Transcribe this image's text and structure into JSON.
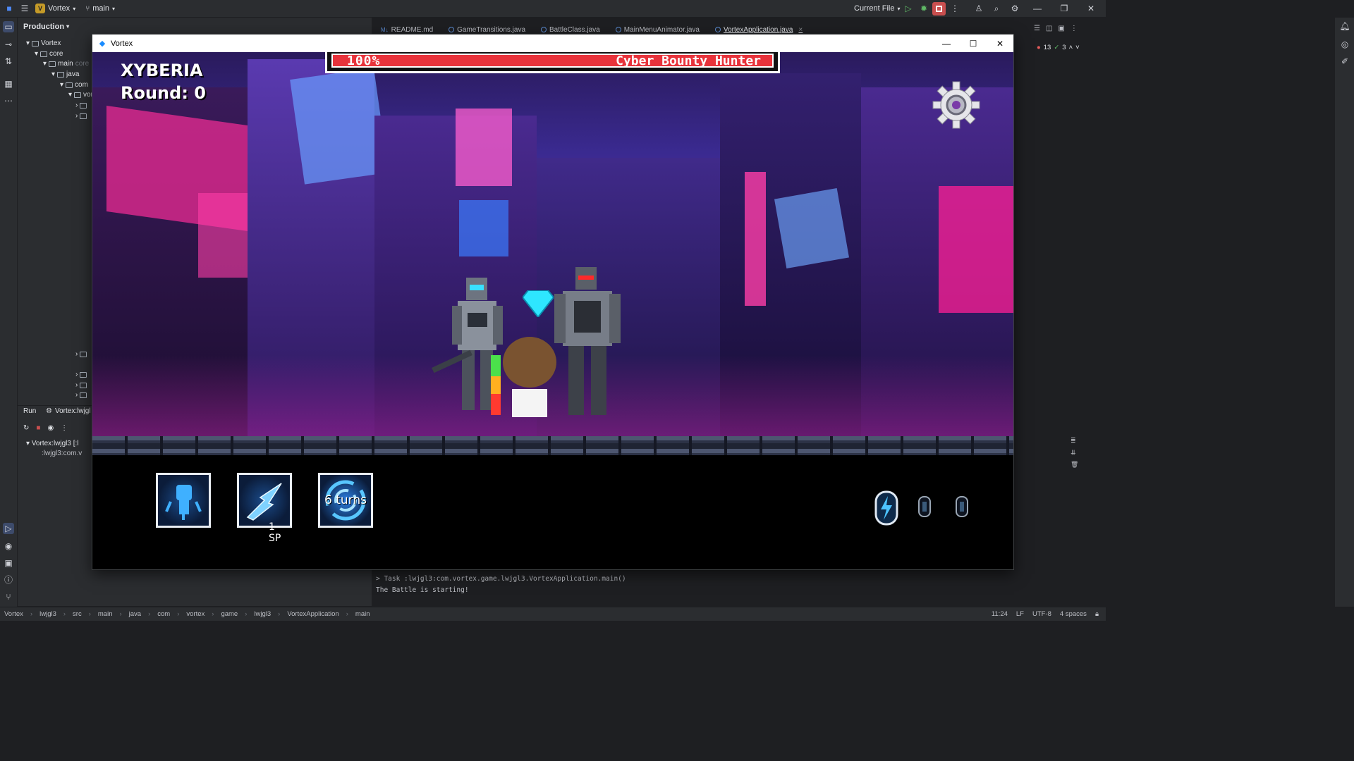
{
  "ide": {
    "project_name": "Vortex",
    "project_badge": "V",
    "branch": "main",
    "run_config": "Current File",
    "project_pane_title": "Production",
    "tree": [
      {
        "label": "Vortex",
        "depth": 0
      },
      {
        "label": "core",
        "depth": 1
      },
      {
        "label": "main",
        "depth": 2,
        "suffix": "core"
      },
      {
        "label": "java",
        "depth": 3
      },
      {
        "label": "com",
        "depth": 4
      },
      {
        "label": "vor",
        "depth": 5
      }
    ],
    "tabs": [
      {
        "label": "README.md",
        "active": false
      },
      {
        "label": "GameTransitions.java",
        "active": false
      },
      {
        "label": "BattleClass.java",
        "active": false
      },
      {
        "label": "MainMenuAnimator.java",
        "active": false
      },
      {
        "label": "VortexApplication.java",
        "active": true
      }
    ],
    "problems": {
      "errors": "13",
      "warnings": "3"
    },
    "run_tab": "Run",
    "run_config_tab": "Vortex:lwjgl",
    "run_tree": [
      "Vortex:lwjgl3 [:l",
      ":lwjgl3:com.v"
    ],
    "console_lines": [
      "> Task :lwjgl3:com.vortex.game.lwjgl3.VortexApplication.main()",
      "The Battle is starting!"
    ],
    "breadcrumb": [
      "Vortex",
      "lwjgl3",
      "src",
      "main",
      "java",
      "com",
      "vortex",
      "game",
      "lwjgl3",
      "VortexApplication",
      "main"
    ],
    "status": {
      "position": "11:24",
      "line_ending": "LF",
      "encoding": "UTF-8",
      "indent": "4 spaces"
    }
  },
  "game": {
    "window_title": "Vortex",
    "zone_name": "XYBERIA",
    "round_label": "Round: 0",
    "enemy_health_percent": "100%",
    "enemy_health_fraction": 1.0,
    "enemy_name": "Cyber Bounty Hunter",
    "skills": [
      {
        "icon": "fist-icon",
        "label": ""
      },
      {
        "icon": "lightning-strike-icon",
        "label": "",
        "cost": "1 SP"
      },
      {
        "icon": "vortex-icon",
        "label": "6 turns"
      }
    ],
    "energy_charges": {
      "filled": 1,
      "total": 3
    }
  }
}
